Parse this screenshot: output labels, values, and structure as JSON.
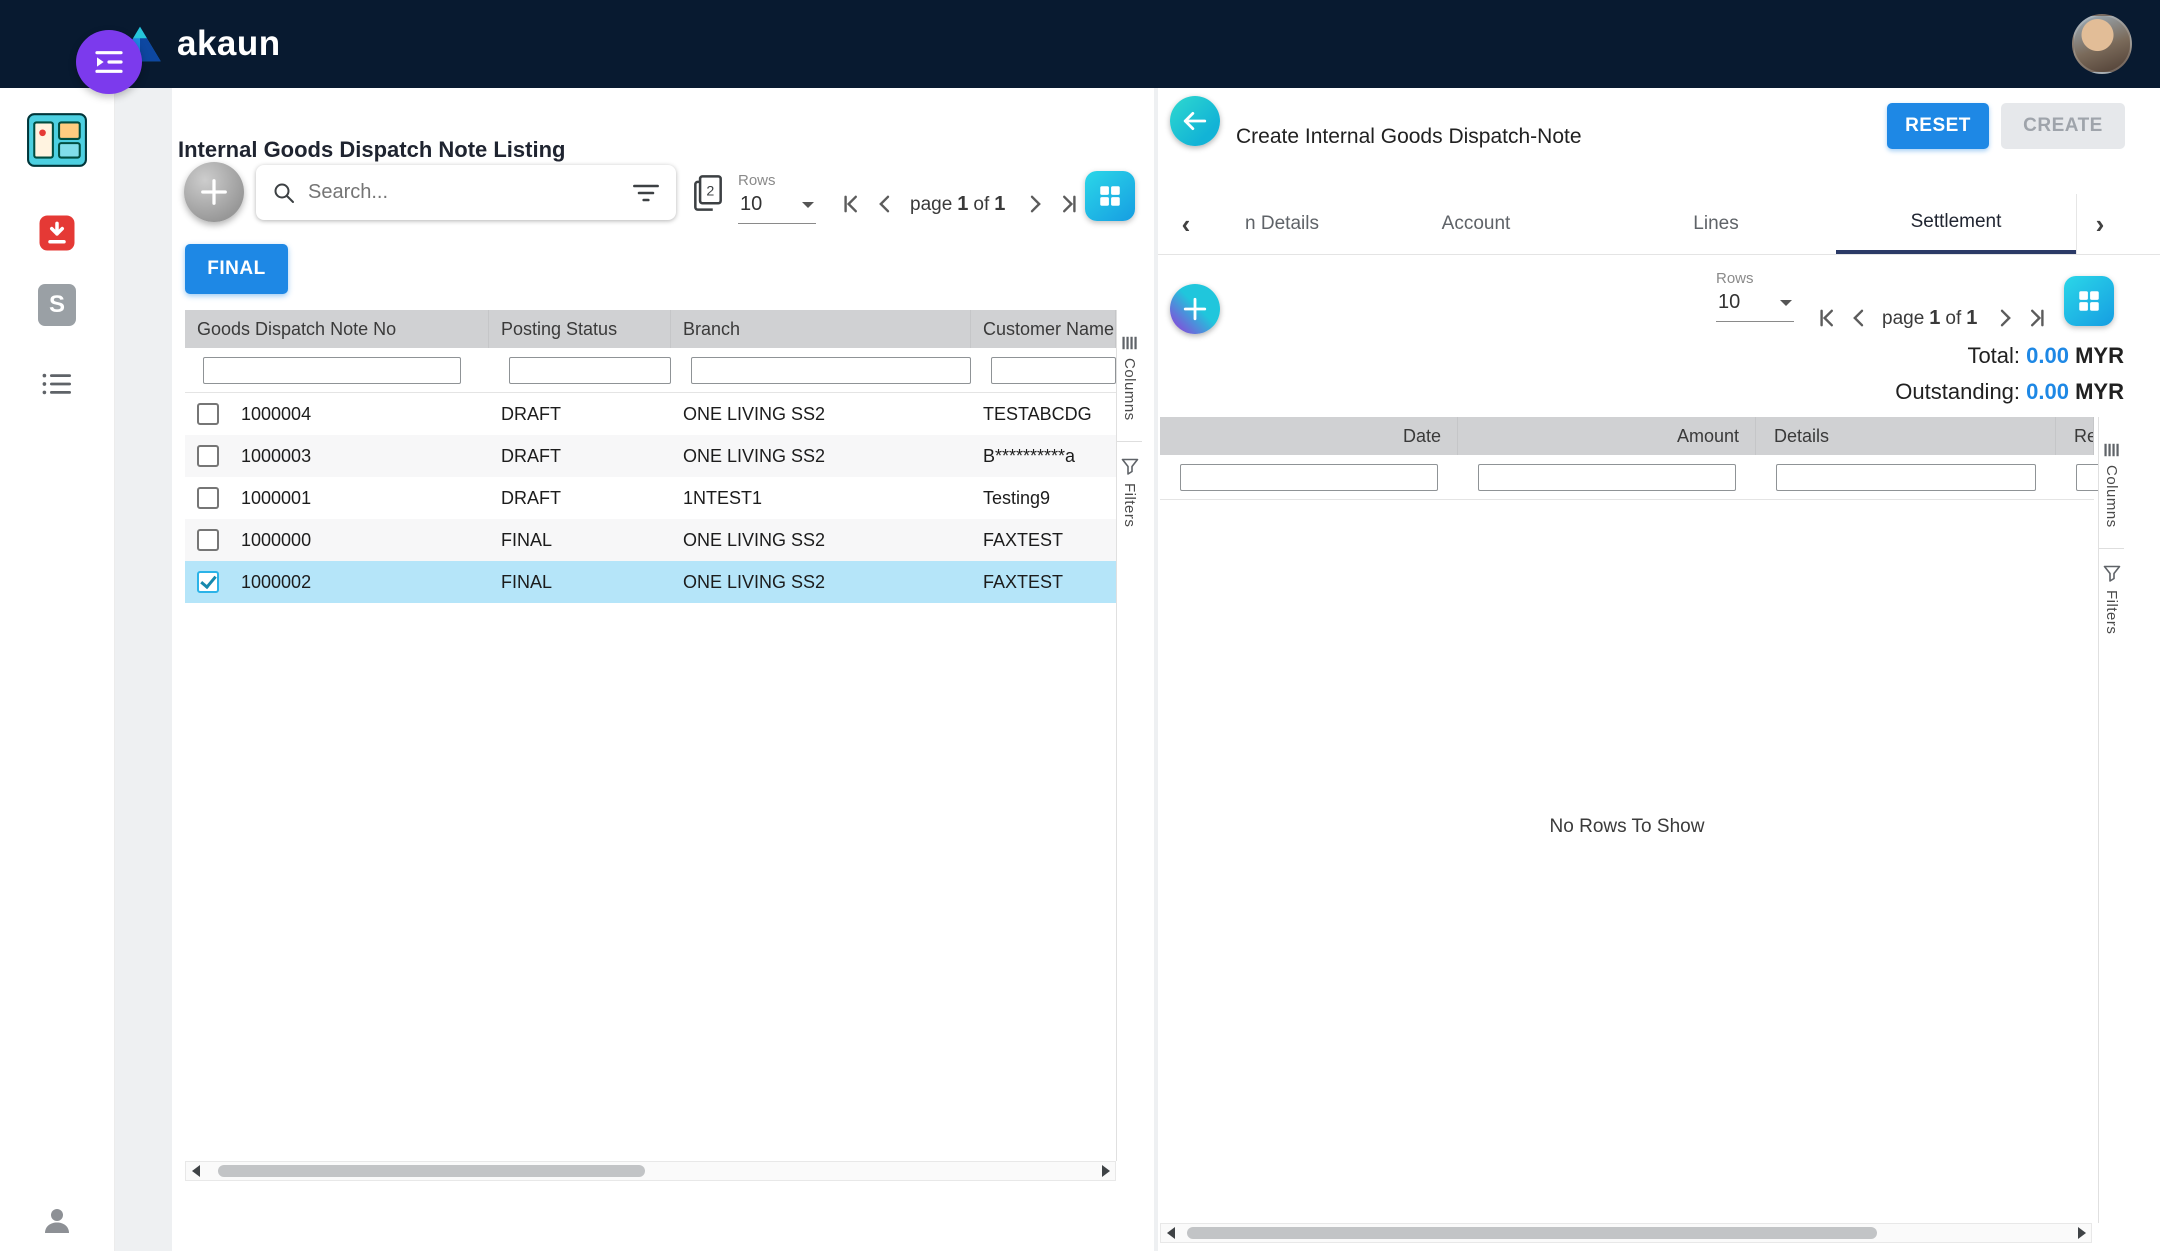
{
  "navbar": {
    "brand": "akaun"
  },
  "sidebar": {
    "s_icon_label": "S"
  },
  "listing": {
    "title": "Internal Goods Dispatch Note Listing",
    "search": {
      "placeholder": "Search..."
    },
    "rows_label": "Rows",
    "rows_value": "10",
    "pagination": {
      "page_word": "page",
      "current": "1",
      "of_word": "of",
      "total": "1"
    },
    "final_button": "FINAL",
    "table": {
      "columns": [
        "Goods Dispatch Note No",
        "Posting Status",
        "Branch",
        "Customer Name"
      ],
      "rows": [
        {
          "note_no": "1000004",
          "posting_status": "DRAFT",
          "branch": "ONE LIVING SS2",
          "customer_name": "TESTABCDG",
          "checked": false
        },
        {
          "note_no": "1000003",
          "posting_status": "DRAFT",
          "branch": "ONE LIVING SS2",
          "customer_name": "B**********a",
          "checked": false
        },
        {
          "note_no": "1000001",
          "posting_status": "DRAFT",
          "branch": "1NTEST1",
          "customer_name": "Testing9",
          "checked": false
        },
        {
          "note_no": "1000000",
          "posting_status": "FINAL",
          "branch": "ONE LIVING SS2",
          "customer_name": "FAXTEST",
          "checked": false
        },
        {
          "note_no": "1000002",
          "posting_status": "FINAL",
          "branch": "ONE LIVING SS2",
          "customer_name": "FAXTEST",
          "checked": true
        }
      ]
    },
    "side_tabs": {
      "columns": "Columns",
      "filters": "Filters"
    }
  },
  "detail": {
    "title": "Create Internal Goods Dispatch-Note",
    "reset_button": "RESET",
    "create_button": "CREATE",
    "tabs": [
      "n Details",
      "Account",
      "Lines",
      "Settlement"
    ],
    "active_tab": "Settlement",
    "rows_label": "Rows",
    "rows_value": "10",
    "pagination": {
      "page_word": "page",
      "current": "1",
      "of_word": "of",
      "total": "1"
    },
    "totals": {
      "total_label": "Total:",
      "total_value": "0.00",
      "total_currency": "MYR",
      "outstanding_label": "Outstanding:",
      "outstanding_value": "0.00",
      "outstanding_currency": "MYR"
    },
    "table": {
      "columns": [
        "Date",
        "Amount",
        "Details",
        "Re"
      ],
      "empty_message": "No Rows To Show"
    },
    "side_tabs": {
      "columns": "Columns",
      "filters": "Filters"
    }
  },
  "colors": {
    "accent_blue": "#1e88e5",
    "cyan": "#1fc8dc",
    "navy": "#081a30",
    "selected_row": "#b5e5f9"
  }
}
